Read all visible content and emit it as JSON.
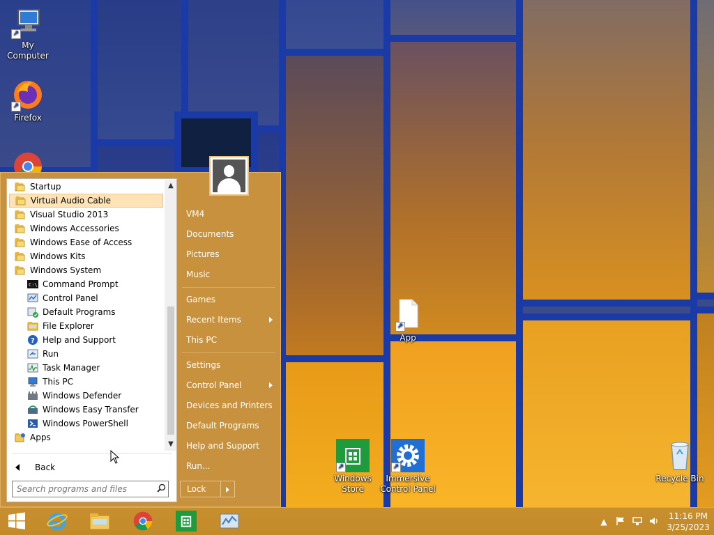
{
  "desktop": {
    "icons": [
      {
        "label": "My Computer",
        "icon": "computer-icon"
      },
      {
        "label": "Firefox",
        "icon": "firefox-icon"
      },
      {
        "label": "App",
        "icon": "file-icon"
      },
      {
        "label": "Windows\nStore",
        "line1": "Windows",
        "line2": "Store",
        "icon": "store-icon"
      },
      {
        "label": "Immersive Control Panel",
        "line1": "Immersive",
        "line2": "Control Panel",
        "icon": "gear-icon"
      },
      {
        "label": "Recycle Bin",
        "icon": "recycle-bin-icon"
      }
    ]
  },
  "start_menu": {
    "programs": [
      {
        "label": "Startup",
        "type": "folder"
      },
      {
        "label": "Virtual Audio Cable",
        "type": "folder",
        "highlighted": true
      },
      {
        "label": "Visual Studio 2013",
        "type": "folder"
      },
      {
        "label": "Windows Accessories",
        "type": "folder"
      },
      {
        "label": "Windows Ease of Access",
        "type": "folder"
      },
      {
        "label": "Windows Kits",
        "type": "folder"
      },
      {
        "label": "Windows System",
        "type": "folder"
      },
      {
        "label": "Command Prompt",
        "type": "app",
        "icon": "cmd-icon"
      },
      {
        "label": "Control Panel",
        "type": "app",
        "icon": "control-panel-icon"
      },
      {
        "label": "Default Programs",
        "type": "app",
        "icon": "default-programs-icon"
      },
      {
        "label": "File Explorer",
        "type": "app",
        "icon": "file-explorer-icon"
      },
      {
        "label": "Help and Support",
        "type": "app",
        "icon": "help-icon"
      },
      {
        "label": "Run",
        "type": "app",
        "icon": "run-icon"
      },
      {
        "label": "Task Manager",
        "type": "app",
        "icon": "task-manager-icon"
      },
      {
        "label": "This PC",
        "type": "app",
        "icon": "computer-icon"
      },
      {
        "label": "Windows Defender",
        "type": "app",
        "icon": "defender-icon"
      },
      {
        "label": "Windows Easy Transfer",
        "type": "app",
        "icon": "easy-transfer-icon"
      },
      {
        "label": "Windows PowerShell",
        "type": "app",
        "icon": "powershell-icon"
      },
      {
        "label": "Apps",
        "type": "folder-apps"
      }
    ],
    "back_label": "Back",
    "search_placeholder": "Search programs and files",
    "right_items": [
      {
        "label": "VM4",
        "arrow": false
      },
      {
        "label": "Documents",
        "arrow": false
      },
      {
        "label": "Pictures",
        "arrow": false
      },
      {
        "label": "Music",
        "arrow": false
      },
      {
        "sep": true
      },
      {
        "label": "Games",
        "arrow": false
      },
      {
        "label": "Recent Items",
        "arrow": true
      },
      {
        "label": "This PC",
        "arrow": false
      },
      {
        "sep": true
      },
      {
        "label": "Settings",
        "arrow": false
      },
      {
        "label": "Control Panel",
        "arrow": true
      },
      {
        "label": "Devices and Printers",
        "arrow": false
      },
      {
        "label": "Default Programs",
        "arrow": false
      },
      {
        "label": "Help and Support",
        "arrow": false
      },
      {
        "label": "Run...",
        "arrow": false
      }
    ],
    "lock_label": "Lock"
  },
  "taskbar": {
    "items": [
      "start-icon",
      "internet-explorer-icon",
      "file-explorer-icon",
      "chrome-icon",
      "store-icon",
      "control-panel-icon"
    ],
    "time": "11:16 PM",
    "date": "3/25/2023"
  },
  "colors": {
    "accent": "#c8913e",
    "highlight": "#fde3b6"
  }
}
